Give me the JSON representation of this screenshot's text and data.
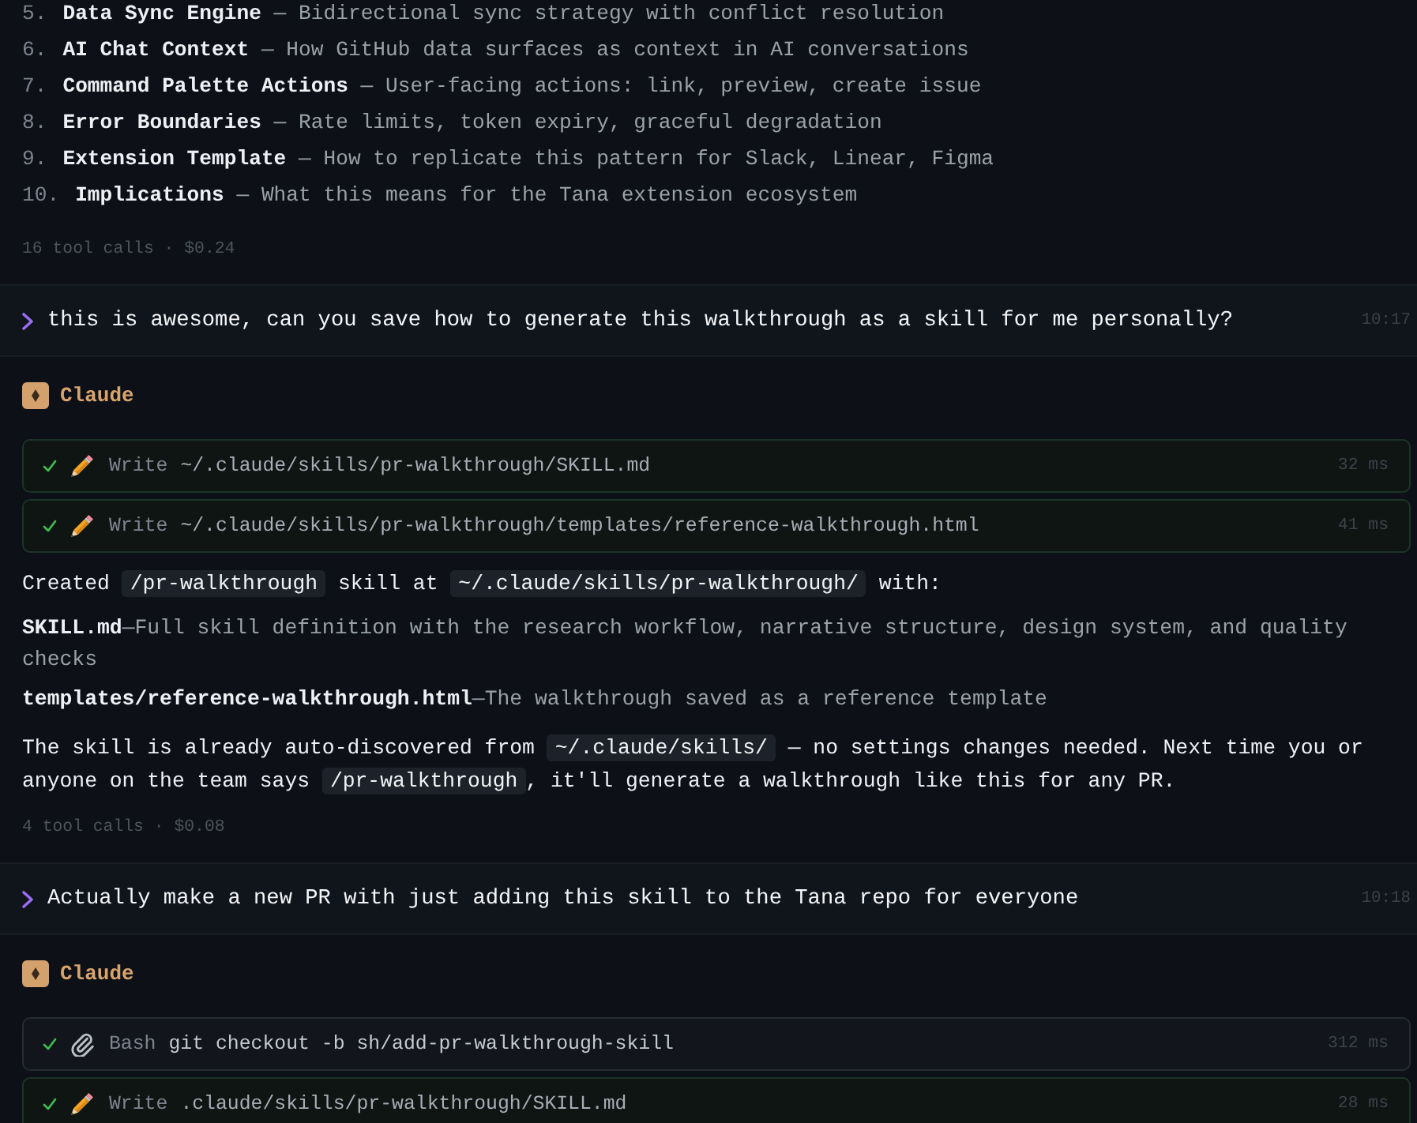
{
  "previous_reply": {
    "list": [
      {
        "number": "5.",
        "text": "**Data Sync Engine** — Bidirectional sync strategy with conflict resolution"
      },
      {
        "number": "6.",
        "text": "**AI Chat Context** — How GitHub data surfaces as context in AI conversations"
      },
      {
        "number": "7.",
        "text": "**Command Palette Actions** — User-facing actions: link, preview, create issue"
      },
      {
        "number": "8.",
        "text": "**Error Boundaries** — Rate limits, token expiry, graceful degradation"
      },
      {
        "number": "9.",
        "text": "**Extension Template** — How to replicate this pattern for Slack, Linear, Figma"
      },
      {
        "number": "10.",
        "text": "**Implications** — What this means for the Tana extension ecosystem"
      }
    ],
    "footer": "16 tool calls · $0.24"
  },
  "turns": [
    {
      "user": {
        "text": "this is awesome, can you save how to generate this walkthrough as a skill for me personally?",
        "time": "10:17"
      },
      "assistant": {
        "name": "Claude",
        "tools": [
          {
            "kind": "write",
            "succeeded": true,
            "tool": "Write",
            "target": "~/.claude/skills/pr-walkthrough/SKILL.md",
            "duration": "32 ms"
          },
          {
            "kind": "write",
            "succeeded": true,
            "tool": "Write",
            "target": "~/.claude/skills/pr-walkthrough/templates/reference-walkthrough.html",
            "duration": "41 ms"
          }
        ],
        "paragraphs": [
          {
            "kind": "text",
            "segments": [
              {
                "kind": "plain",
                "text": "Created "
              },
              {
                "kind": "code",
                "text": "/pr-walkthrough"
              },
              {
                "kind": "plain",
                "text": " skill at "
              },
              {
                "kind": "code",
                "text": "~/.claude/skills/pr-walkthrough/"
              },
              {
                "kind": "plain",
                "text": " with:"
              }
            ]
          },
          {
            "kind": "definition",
            "text": "**SKILL.md**—Full skill definition with the research workflow, narrative structure, design system, and quality checks"
          },
          {
            "kind": "definition",
            "text": "**templates/reference-walkthrough.html**—The walkthrough saved as a reference template"
          },
          {
            "kind": "text",
            "segments": [
              {
                "kind": "plain",
                "text": "The skill is already auto-discovered from "
              },
              {
                "kind": "code",
                "text": "~/.claude/skills/"
              },
              {
                "kind": "plain",
                "text": " — no settings changes needed. Next time you or anyone on the team says "
              },
              {
                "kind": "code",
                "text": "/pr-walkthrough"
              },
              {
                "kind": "plain",
                "text": ", it'll generate a walkthrough like this for any PR."
              }
            ]
          }
        ],
        "footer": "4 tool calls · $0.08"
      }
    },
    {
      "user": {
        "text": "Actually make a new PR with just adding this skill to the Tana repo for everyone",
        "time": "10:18"
      },
      "assistant": {
        "name": "Claude",
        "tools": [
          {
            "kind": "bash",
            "succeeded": true,
            "tool": "Bash",
            "target": "git checkout -b sh/add-pr-walkthrough-skill",
            "duration": "312 ms"
          },
          {
            "kind": "write",
            "succeeded": true,
            "tool": "Write",
            "target": ".claude/skills/pr-walkthrough/SKILL.md",
            "duration": "28 ms"
          }
        ]
      }
    }
  ]
}
